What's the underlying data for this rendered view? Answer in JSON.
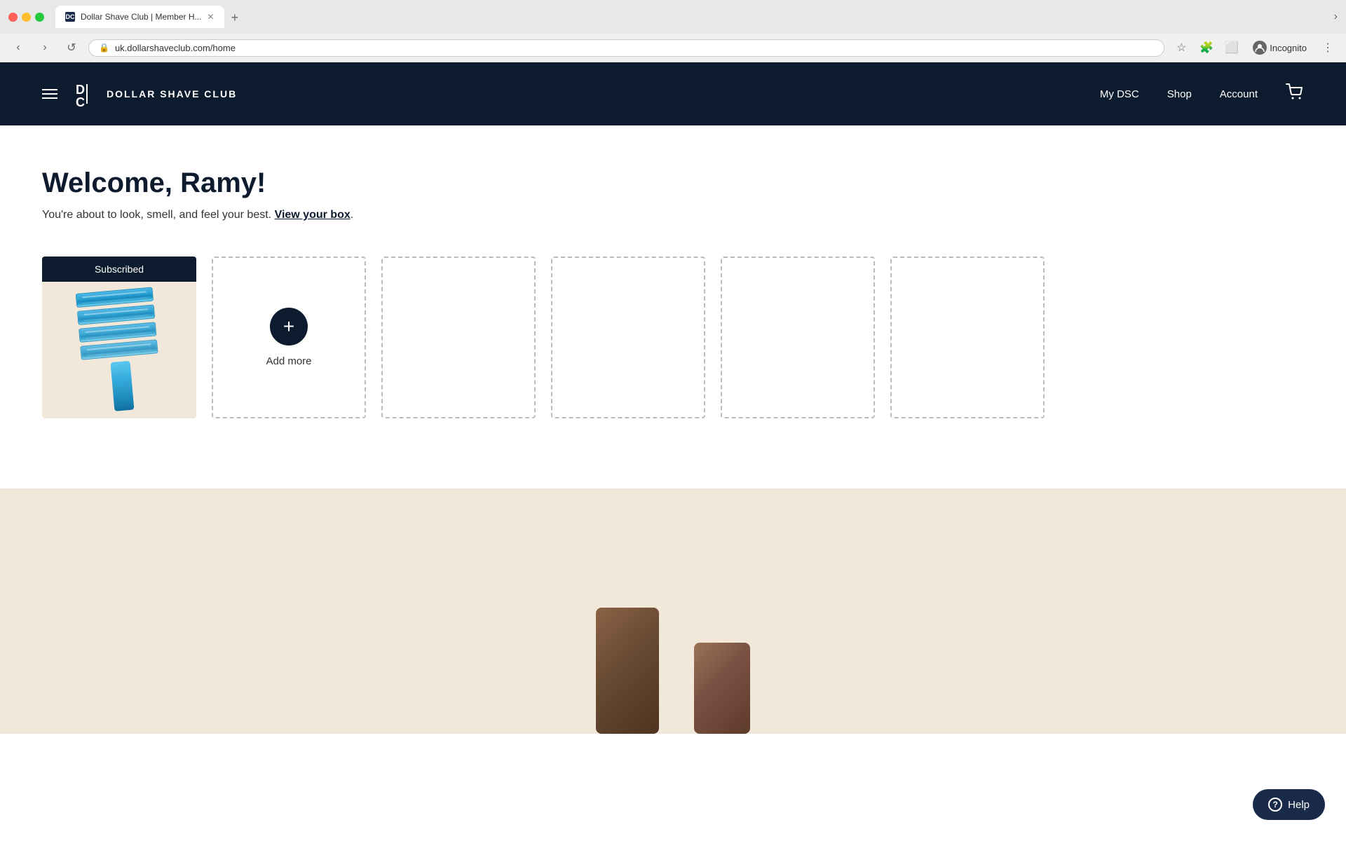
{
  "browser": {
    "tab": {
      "title": "Dollar Shave Club | Member H...",
      "favicon_label": "DSC"
    },
    "new_tab_button": "+",
    "chevron_right": "›",
    "nav": {
      "back_label": "‹",
      "forward_label": "›",
      "reload_label": "↺"
    },
    "address": {
      "url": "uk.dollarshaveclub.com/home",
      "lock_icon": "🔒"
    },
    "actions": {
      "star_label": "☆",
      "extensions_label": "🧩",
      "sidebar_label": "⬜",
      "incognito_label": "Incognito",
      "menu_label": "⋮"
    }
  },
  "header": {
    "logo_text": "DOLLAR SHAVE CLUB",
    "nav_items": [
      {
        "id": "my-dsc",
        "label": "My DSC"
      },
      {
        "id": "shop",
        "label": "Shop"
      },
      {
        "id": "account",
        "label": "Account"
      }
    ]
  },
  "main": {
    "welcome_heading": "Welcome, Ramy!",
    "welcome_sub_text": "You're about to look, smell, and feel your best.",
    "view_box_link": "View your box",
    "subscribed_label": "Subscribed",
    "add_more_label": "Add more",
    "empty_slots": 5
  },
  "help": {
    "label": "Help"
  }
}
